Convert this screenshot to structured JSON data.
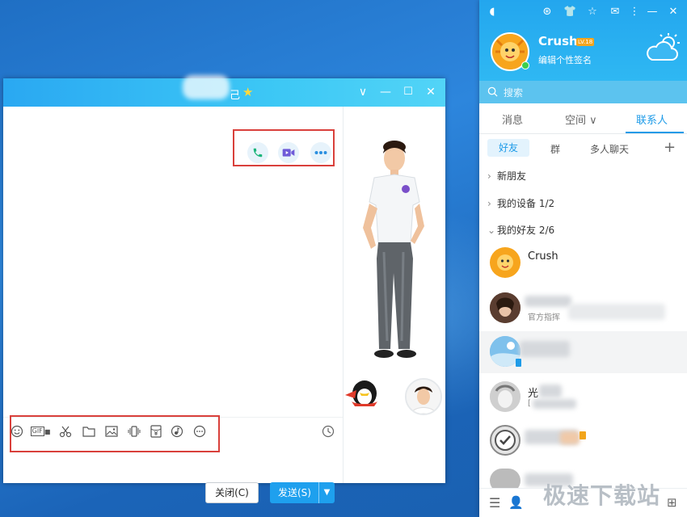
{
  "chat_window": {
    "title_suffix": "己",
    "controls": {
      "dropdown": "∨",
      "minimize": "—",
      "maximize": "☐",
      "close": "✕"
    },
    "toolbar_icons": [
      "smile-icon",
      "gif-icon",
      "scissors-icon",
      "folder-icon",
      "image-icon",
      "shake-icon",
      "red-packet-icon",
      "music-icon",
      "more-icon"
    ],
    "gif_label": "GIF",
    "close_label": "关闭(C)",
    "send_label": "发送(S)",
    "send_dropdown": "▼"
  },
  "qq_panel": {
    "username": "Crush",
    "level_badge": "LV.18",
    "signature": "编辑个性签名",
    "search_placeholder": "搜索",
    "tabs": [
      {
        "label": "消息"
      },
      {
        "label": "空间 ∨"
      },
      {
        "label": "联系人"
      }
    ],
    "sub_tabs": [
      "好友",
      "群",
      "多人聊天"
    ],
    "add_symbol": "+",
    "groups": [
      {
        "label": "新朋友"
      },
      {
        "label": "我的设备 1/2"
      },
      {
        "label": "我的好友 2/6"
      }
    ],
    "contacts": [
      {
        "name": "Crush",
        "sub": ""
      },
      {
        "name": "",
        "sub": "官方指挥"
      },
      {
        "name": "",
        "sub": ""
      },
      {
        "name": "光",
        "sub": "["
      },
      {
        "name": "",
        "sub": ""
      },
      {
        "name": "",
        "sub": ""
      }
    ]
  },
  "watermark": "极速下载站",
  "colors": {
    "accent": "#1e9be8",
    "highlight_box": "#d9403b",
    "title_bar": "#2aa8f2"
  }
}
